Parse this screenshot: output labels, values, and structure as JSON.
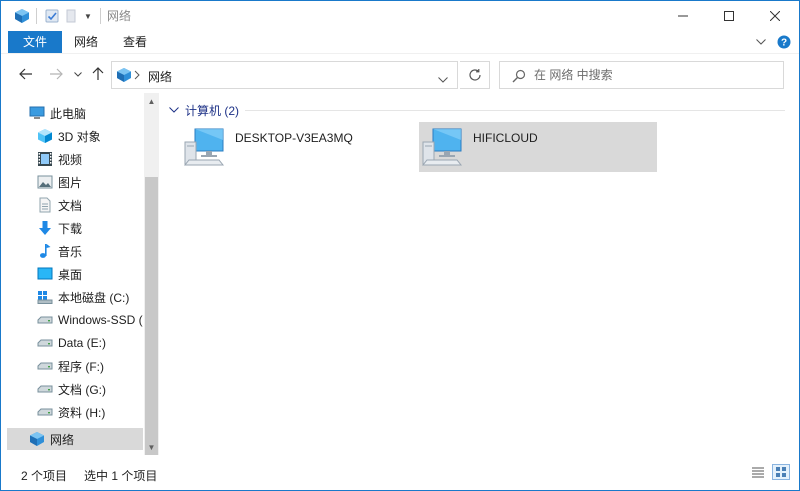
{
  "window": {
    "title": "网络"
  },
  "ribbon": {
    "tabs": [
      {
        "label": "文件",
        "active": true
      },
      {
        "label": "网络",
        "active": false
      },
      {
        "label": "查看",
        "active": false
      }
    ]
  },
  "address": {
    "location": "网络"
  },
  "search": {
    "placeholder": "在 网络 中搜索"
  },
  "nav": {
    "items": [
      {
        "label": "此电脑",
        "icon": "pc-icon"
      },
      {
        "label": "3D 对象",
        "icon": "3d-objects-icon"
      },
      {
        "label": "视频",
        "icon": "video-icon"
      },
      {
        "label": "图片",
        "icon": "pictures-icon"
      },
      {
        "label": "文档",
        "icon": "documents-icon"
      },
      {
        "label": "下载",
        "icon": "download-icon"
      },
      {
        "label": "音乐",
        "icon": "music-icon"
      },
      {
        "label": "桌面",
        "icon": "desktop-icon"
      },
      {
        "label": "本地磁盘 (C:)",
        "icon": "windows-drive-icon"
      },
      {
        "label": "Windows-SSD (",
        "icon": "drive-icon"
      },
      {
        "label": "Data (E:)",
        "icon": "drive-icon"
      },
      {
        "label": "程序 (F:)",
        "icon": "drive-icon"
      },
      {
        "label": "文档 (G:)",
        "icon": "drive-icon"
      },
      {
        "label": "资料 (H:)",
        "icon": "drive-icon"
      },
      {
        "label": "网络",
        "icon": "network-icon",
        "selected": true
      }
    ]
  },
  "content": {
    "group": {
      "label": "计算机 (2)"
    },
    "computers": [
      {
        "name": "DESKTOP-V3EA3MQ",
        "icon": "computer-icon",
        "selected": false
      },
      {
        "name": "HIFICLOUD",
        "icon": "computer-icon",
        "selected": true
      }
    ]
  },
  "status": {
    "count": "2 个项目",
    "selection": "选中 1 个项目"
  },
  "colors": {
    "accent": "#1979ca",
    "selection": "#d9d9d9",
    "group_label": "#1e3287"
  }
}
